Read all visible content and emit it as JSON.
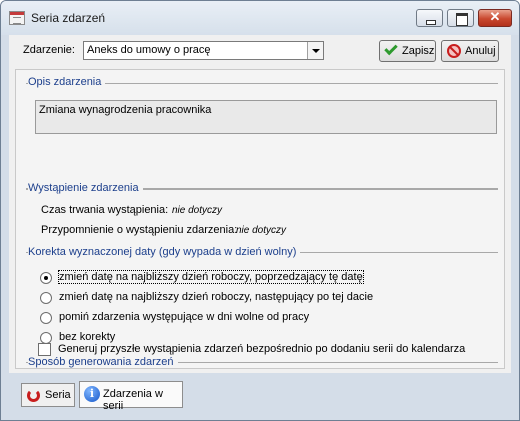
{
  "window": {
    "title": "Seria zdarzeń"
  },
  "toolbar": {
    "event_label": "Zdarzenie:",
    "event_value": "Aneks do umowy o pracę",
    "save_label": "Zapisz",
    "cancel_label": "Anuluj"
  },
  "description": {
    "title": "Opis zdarzenia",
    "text": "Zmiana wynagrodzenia pracownika"
  },
  "occurrence": {
    "title": "Wystąpienie zdarzenia",
    "duration_label": "Czas trwania wystąpienia:",
    "duration_value": "nie dotyczy",
    "reminder_label": "Przypomnienie o wystąpieniu zdarzenia:",
    "reminder_value": "nie dotyczy"
  },
  "correction": {
    "title": "Korekta wyznaczonej daty (gdy wypada w dzień wolny)",
    "options": [
      {
        "label": "zmień datę na najbliższy dzień roboczy, poprzedzający tę datę",
        "selected": true
      },
      {
        "label": "zmień datę na najbliższy dzień roboczy, następujący po tej dacie",
        "selected": false
      },
      {
        "label": "pomiń zdarzenia występujące w dni wolne od pracy",
        "selected": false
      },
      {
        "label": "bez korekty",
        "selected": false
      }
    ]
  },
  "generation": {
    "title": "Sposób generowania zdarzeń",
    "checkbox_label": "Generuj przyszłe wystąpienia zdarzeń bezpośrednio po dodaniu serii do kalendarza",
    "checked": false
  },
  "tabs": [
    {
      "label": "Seria",
      "icon": "refresh-icon",
      "active": false
    },
    {
      "label": "Zdarzenia w serii",
      "icon": "info-icon",
      "active": true
    }
  ]
}
